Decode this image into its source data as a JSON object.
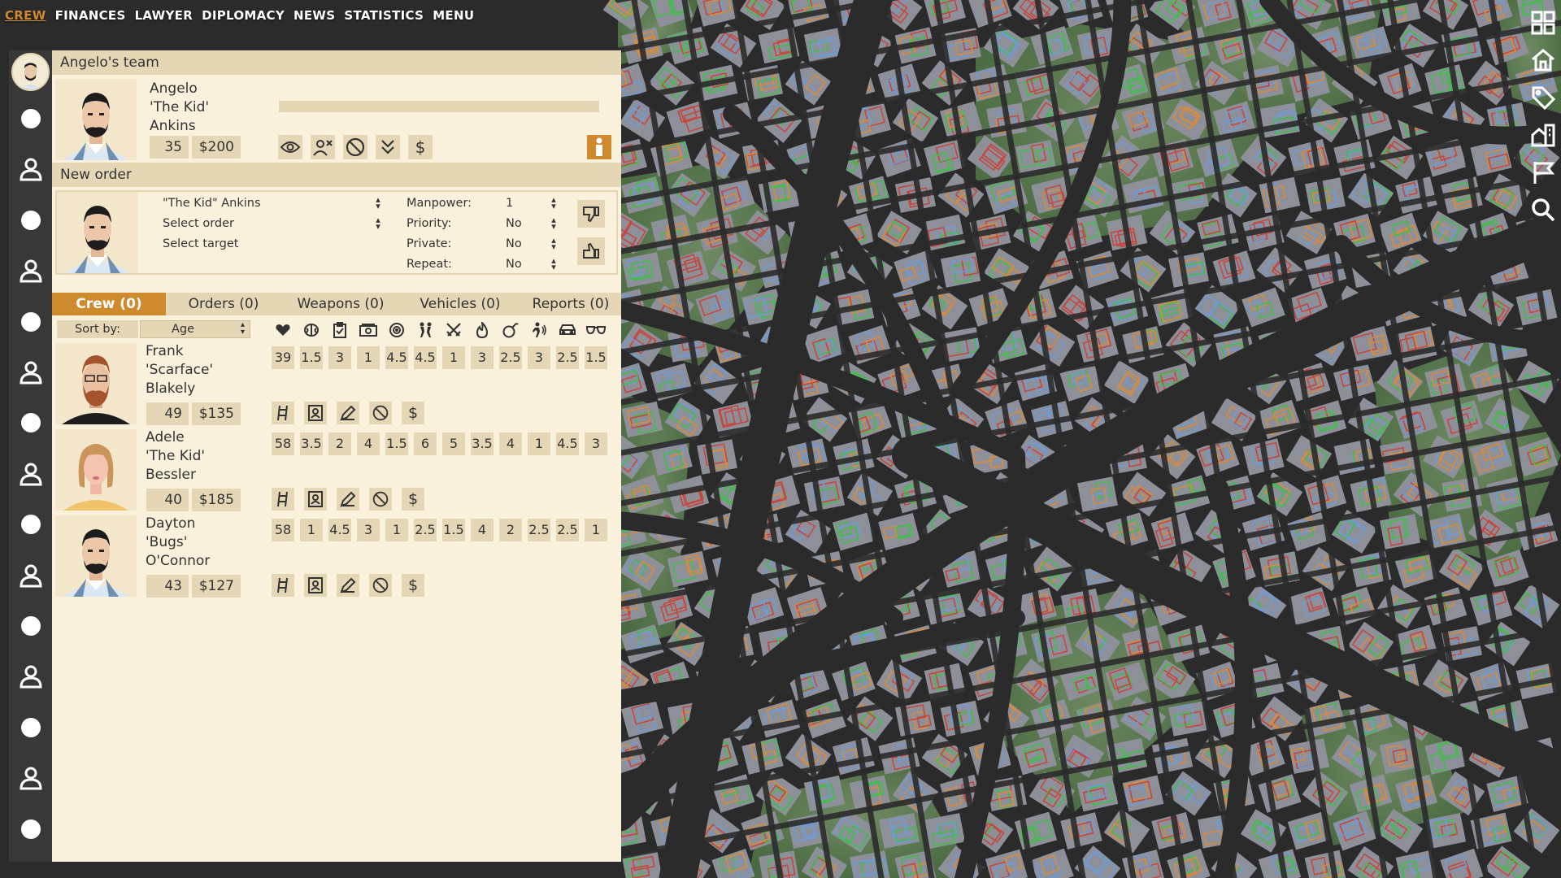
{
  "top_nav": [
    "CREW",
    "FINANCES",
    "LAWYER",
    "DIPLOMACY",
    "NEWS",
    "STATISTICS",
    "MENU"
  ],
  "right_tools": [
    "grid-icon",
    "home-icon",
    "tag-icon",
    "buildings-icon",
    "flag-icon",
    "search-icon"
  ],
  "team": {
    "title": "Angelo's team",
    "leader": {
      "first": "Angelo",
      "nick": "'The Kid'",
      "last": "Ankins",
      "age": "35",
      "pay": "$200",
      "progress": 0
    },
    "leader_actions": [
      "eye-icon",
      "user-remove-icon",
      "ban-icon",
      "double-chevron-down-icon",
      "dollar-icon"
    ]
  },
  "order": {
    "title": "New order",
    "member": "\"The Kid\" Ankins",
    "select_order": "Select order",
    "select_target": "Select target",
    "fields": [
      {
        "label": "Manpower:",
        "value": "1"
      },
      {
        "label": "Priority:",
        "value": "No"
      },
      {
        "label": "Private:",
        "value": "No"
      },
      {
        "label": "Repeat:",
        "value": "No"
      }
    ]
  },
  "tabs": [
    "Crew (0)",
    "Orders (0)",
    "Weapons (0)",
    "Vehicles (0)",
    "Reports (0)"
  ],
  "sort": {
    "label": "Sort by:",
    "value": "Age"
  },
  "stat_icons": [
    "heart-icon",
    "brain-icon",
    "clipboard-icon",
    "money-icon",
    "target-icon",
    "fight-icon",
    "crossed-swords-icon",
    "fire-icon",
    "bomb-icon",
    "sneak-icon",
    "car-icon",
    "glasses-icon"
  ],
  "crew": [
    {
      "first": "Frank",
      "nick": "'Scarface'",
      "last": "Blakely",
      "age": "49",
      "pay": "$135",
      "stats": [
        "39",
        "1.5",
        "3",
        "1",
        "4.5",
        "4.5",
        "1",
        "3",
        "2.5",
        "3",
        "2.5",
        "1.5"
      ]
    },
    {
      "first": "Adele",
      "nick": "'The Kid'",
      "last": "Bessler",
      "age": "40",
      "pay": "$185",
      "stats": [
        "58",
        "3.5",
        "2",
        "4",
        "1.5",
        "6",
        "5",
        "3.5",
        "4",
        "1",
        "4.5",
        "3"
      ]
    },
    {
      "first": "Dayton",
      "nick": "'Bugs'",
      "last": "O'Connor",
      "age": "43",
      "pay": "$127",
      "stats": [
        "58",
        "1",
        "4.5",
        "3",
        "1",
        "2.5",
        "1.5",
        "4",
        "2",
        "2.5",
        "2.5",
        "1"
      ]
    }
  ],
  "crew_actions": [
    "ladder-icon",
    "id-card-icon",
    "pencil-icon",
    "ban-icon",
    "dollar-icon"
  ],
  "colors": {
    "accent": "#d08a2e",
    "panel": "#faf1dc",
    "chip": "#e5d6b6",
    "road": "#2b2b2b",
    "park": "#4f6e45",
    "lot": "#8a8d96"
  }
}
